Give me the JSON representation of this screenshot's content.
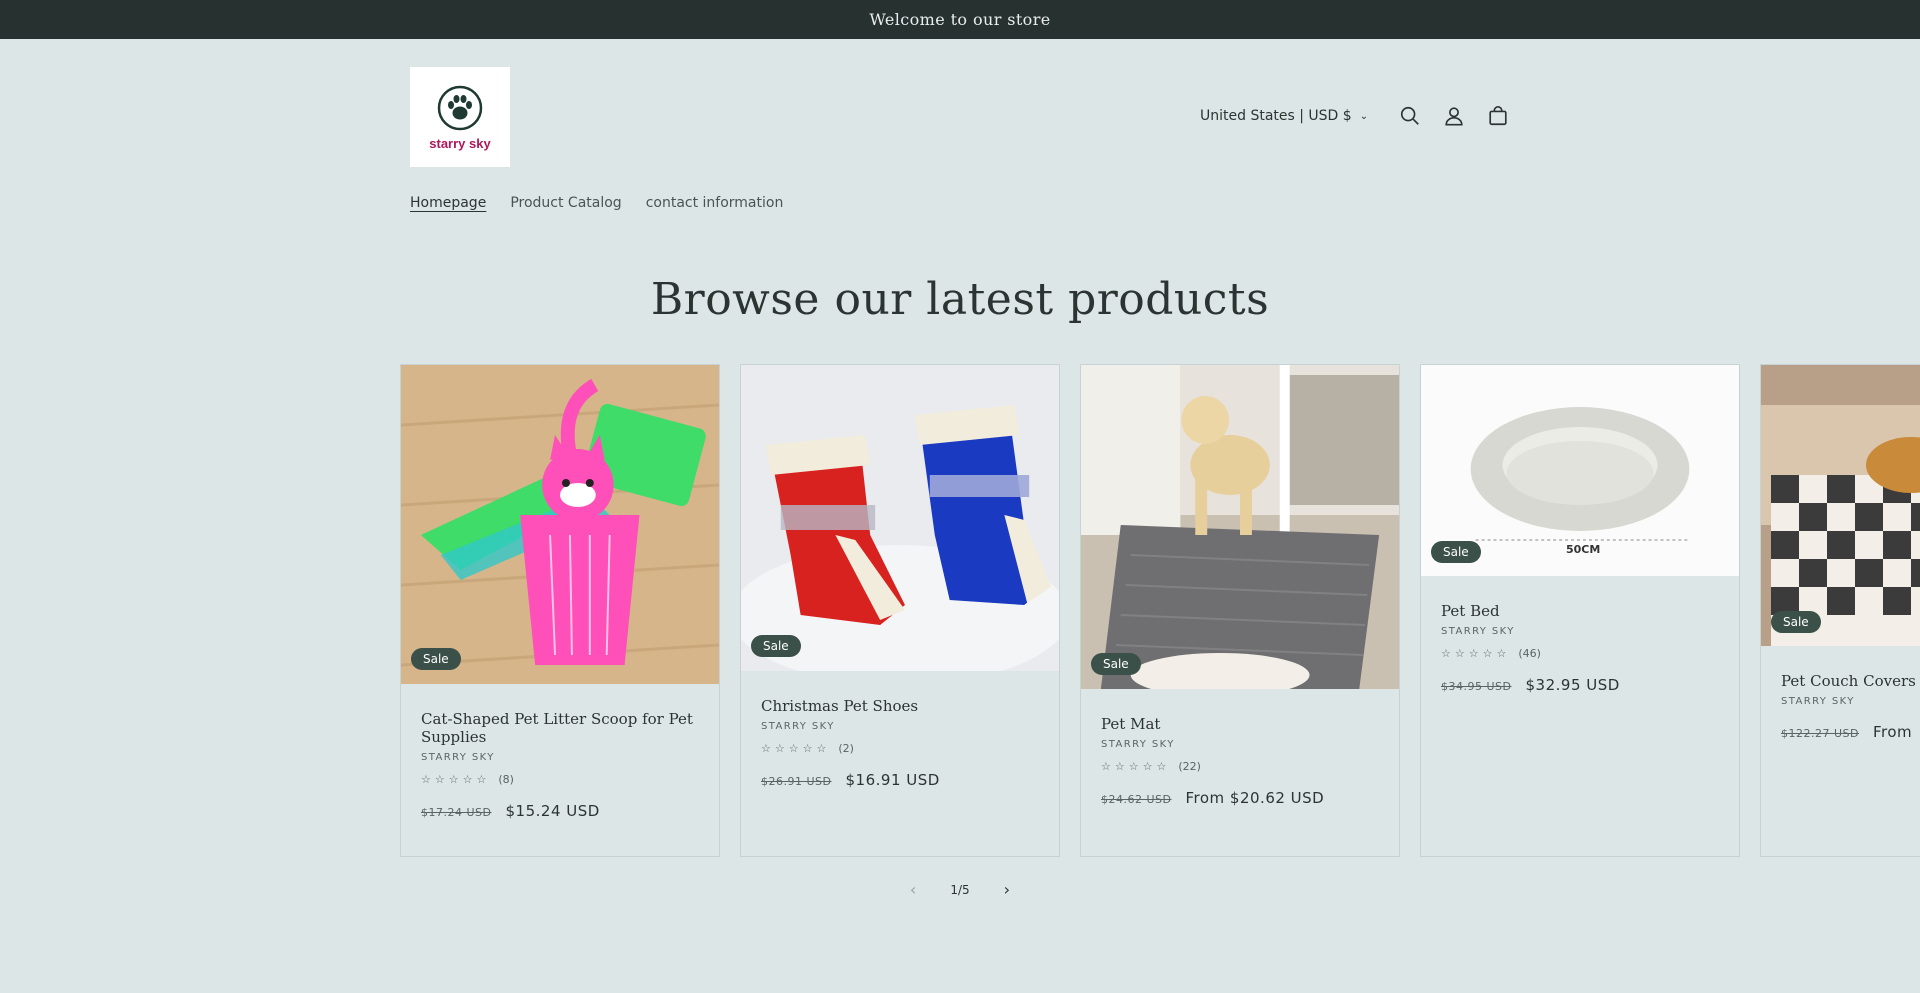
{
  "announcement": "Welcome to our store",
  "logo": {
    "brand": "starry sky"
  },
  "header": {
    "country": "United States | USD $"
  },
  "nav": [
    "Homepage",
    "Product Catalog",
    "contact information"
  ],
  "section_title": "Browse our latest products",
  "products": [
    {
      "title": "Cat-Shaped Pet Litter Scoop for Pet Supplies",
      "vendor": "STARRY SKY",
      "review_count": "(8)",
      "old_price": "$17.24 USD",
      "price": "$15.24 USD",
      "badge": "Sale"
    },
    {
      "title": "Christmas Pet Shoes",
      "vendor": "STARRY SKY",
      "review_count": "(2)",
      "old_price": "$26.91 USD",
      "price": "$16.91 USD",
      "badge": "Sale"
    },
    {
      "title": "Pet Mat",
      "vendor": "STARRY SKY",
      "review_count": "(22)",
      "old_price": "$24.62 USD",
      "price": "From $20.62 USD",
      "badge": "Sale"
    },
    {
      "title": "Pet Bed",
      "vendor": "STARRY SKY",
      "review_count": "(46)",
      "old_price": "$34.95 USD",
      "price": "$32.95 USD",
      "badge": "Sale",
      "image_caption": "50CM"
    },
    {
      "title": "Pet Couch Covers",
      "vendor": "STARRY SKY",
      "review_count": "",
      "old_price": "$122.27 USD",
      "price": "From",
      "badge": "Sale"
    }
  ],
  "pager": {
    "current": "1",
    "total": "5",
    "separator": "/"
  },
  "icons": {
    "search": "search-icon",
    "account": "account-icon",
    "cart": "cart-icon",
    "prev": "chevron-left-icon",
    "next": "chevron-right-icon",
    "logo": "paw-icon"
  },
  "colors": {
    "announcement_bg": "#273130",
    "page_bg": "#dce6e7",
    "badge_bg": "#3a5048",
    "brand": "#b0165a"
  }
}
